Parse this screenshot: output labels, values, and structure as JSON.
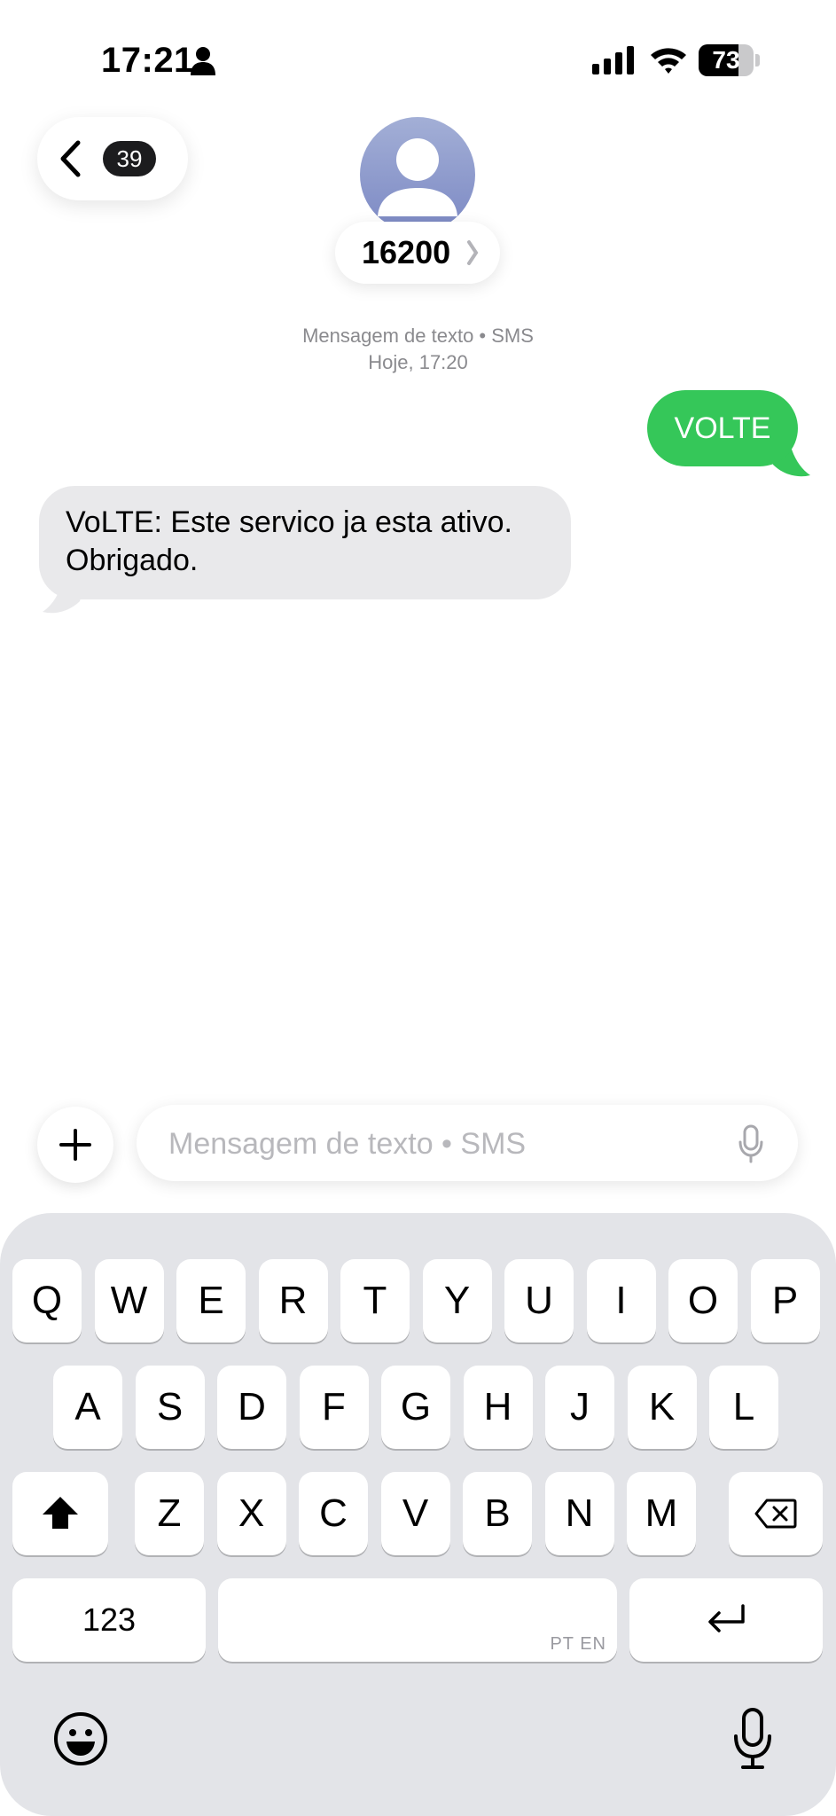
{
  "status_bar": {
    "time": "17:21",
    "battery": "73",
    "battery_level": 73,
    "icons": [
      "person-icon",
      "signal-icon",
      "wifi-icon",
      "battery-icon"
    ]
  },
  "header": {
    "unread_count": "39",
    "contact_name": "16200"
  },
  "conversation_meta": {
    "line1": "Mensagem de texto • SMS",
    "line2": "Hoje, 17:20"
  },
  "messages": [
    {
      "direction": "outgoing",
      "text": "VOLTE"
    },
    {
      "direction": "incoming",
      "text_line1": "VoLTE: Este servico ja esta ativo.",
      "text_line2": "Obrigado."
    }
  ],
  "composer": {
    "placeholder": "Mensagem de texto • SMS"
  },
  "keyboard": {
    "row1": [
      "Q",
      "W",
      "E",
      "R",
      "T",
      "Y",
      "U",
      "I",
      "O",
      "P"
    ],
    "row2": [
      "A",
      "S",
      "D",
      "F",
      "G",
      "H",
      "J",
      "K",
      "L"
    ],
    "row3": [
      "Z",
      "X",
      "C",
      "V",
      "B",
      "N",
      "M"
    ],
    "numbers_label": "123",
    "space_hint": "PT EN"
  },
  "colors": {
    "outgoing_bubble": "#35c759",
    "incoming_bubble": "#e9e9eb",
    "keyboard_bg": "#e3e4e8"
  }
}
